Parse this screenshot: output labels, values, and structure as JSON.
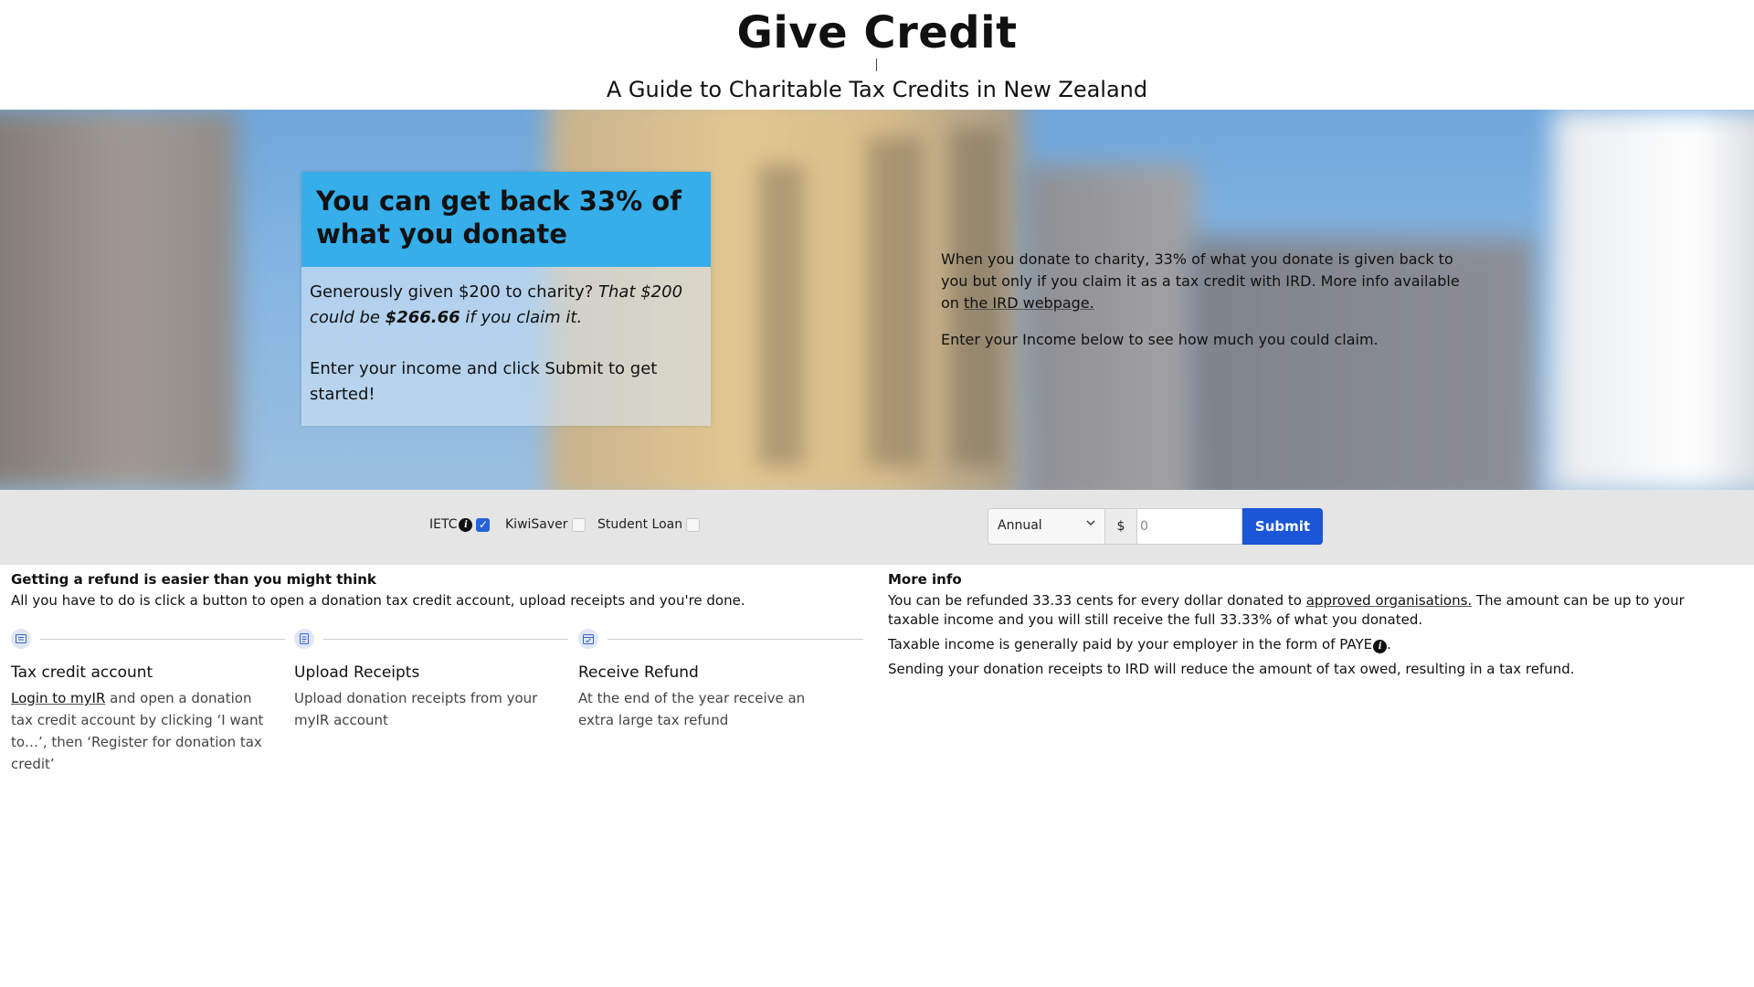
{
  "header": {
    "title": "Give Credit",
    "subtitle": "A Guide to Charitable Tax Credits in New Zealand"
  },
  "hero": {
    "card": {
      "heading": "You can get back 33% of what you donate",
      "p1_a": "Generously given $200 to charity? ",
      "p1_b": "That $200 could be ",
      "p1_c": "$266.66",
      "p1_d": " if you claim it.",
      "p2": "Enter your income and click Submit to get started!"
    },
    "info": {
      "p1": "When you donate to charity, 33% of what you donate is given back to you but only if you claim it as a tax credit with IRD. More info available on ",
      "p1_link": "the IRD webpage.",
      "p2": "Enter your Income below to see how much you could claim."
    }
  },
  "controls": {
    "ietc_label": "IETC",
    "ietc_checked": true,
    "kiwisaver_label": "KiwiSaver",
    "kiwisaver_checked": false,
    "student_loan_label": "Student Loan",
    "student_loan_checked": false,
    "period_selected": "Annual",
    "currency_symbol": "$",
    "amount_placeholder": "0",
    "submit_label": "Submit",
    "accent_color": "#1a56d6"
  },
  "steps_section": {
    "heading": "Getting a refund is easier than you might think",
    "intro": "All you have to do is click a button to open a donation tax credit account, upload receipts and you're done.",
    "steps": [
      {
        "icon": "id-card-icon",
        "title": "Tax credit account",
        "link": "Login to myIR",
        "desc": " and open a donation tax credit account by clicking ‘I want to…’, then ‘Register for donation tax credit’"
      },
      {
        "icon": "document-icon",
        "title": "Upload Receipts",
        "desc": "Upload donation receipts from your myIR account"
      },
      {
        "icon": "calendar-icon",
        "title": "Receive Refund",
        "desc": "At the end of the year receive an extra large tax refund"
      }
    ]
  },
  "more_info": {
    "heading": "More info",
    "p1_a": "You can be refunded 33.33 cents for every dollar donated to ",
    "p1_link": "approved organisations.",
    "p1_b": " The amount can be up to your taxable income and you will still receive the full 33.33% of what you donated.",
    "p2_a": "Taxable income is generally paid by your employer in the form of PAYE",
    "p2_b": ".",
    "p3": "Sending your donation receipts to IRD will reduce the amount of tax owed, resulting in a tax refund."
  }
}
